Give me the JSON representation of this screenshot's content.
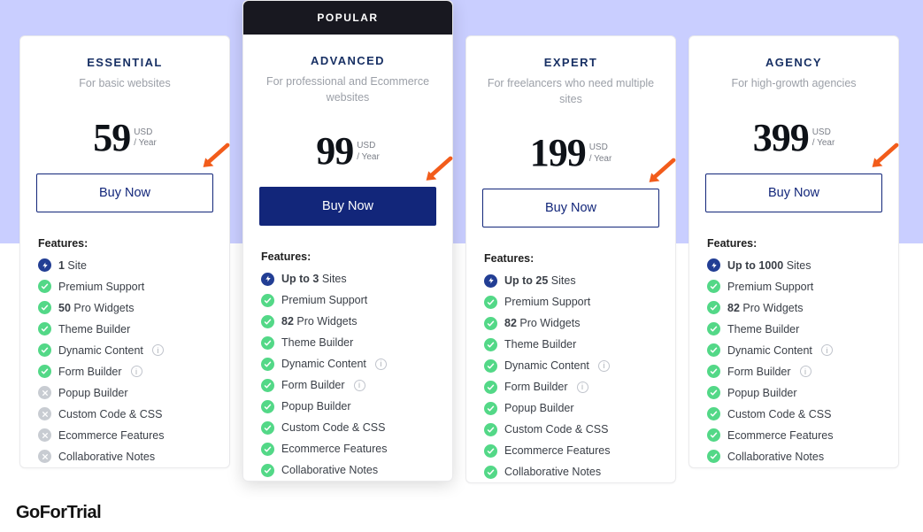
{
  "footer_logo": "GoForTrial",
  "buy_label": "Buy Now",
  "features_title": "Features:",
  "currency": "USD",
  "period": "/ Year",
  "plans": [
    {
      "name": "ESSENTIAL",
      "desc": "For basic websites",
      "price": "59",
      "popular": false,
      "popular_label": "",
      "features": [
        {
          "icon": "bolt",
          "bold": "1",
          "text": " Site",
          "info": false
        },
        {
          "icon": "check",
          "bold": "",
          "text": "Premium Support",
          "info": false
        },
        {
          "icon": "check",
          "bold": "50",
          "text": " Pro Widgets",
          "info": false
        },
        {
          "icon": "check",
          "bold": "",
          "text": "Theme Builder",
          "info": false
        },
        {
          "icon": "check",
          "bold": "",
          "text": "Dynamic Content",
          "info": true
        },
        {
          "icon": "check",
          "bold": "",
          "text": "Form Builder",
          "info": true
        },
        {
          "icon": "no",
          "bold": "",
          "text": "Popup Builder",
          "info": false
        },
        {
          "icon": "no",
          "bold": "",
          "text": "Custom Code & CSS",
          "info": false
        },
        {
          "icon": "no",
          "bold": "",
          "text": "Ecommerce Features",
          "info": false
        },
        {
          "icon": "no",
          "bold": "",
          "text": "Collaborative Notes",
          "info": false
        }
      ]
    },
    {
      "name": "ADVANCED",
      "desc": "For professional and Ecommerce websites",
      "price": "99",
      "popular": true,
      "popular_label": "POPULAR",
      "features": [
        {
          "icon": "bolt",
          "bold": "Up to 3",
          "text": " Sites",
          "info": false
        },
        {
          "icon": "check",
          "bold": "",
          "text": "Premium Support",
          "info": false
        },
        {
          "icon": "check",
          "bold": "82",
          "text": " Pro Widgets",
          "info": false
        },
        {
          "icon": "check",
          "bold": "",
          "text": "Theme Builder",
          "info": false
        },
        {
          "icon": "check",
          "bold": "",
          "text": "Dynamic Content",
          "info": true
        },
        {
          "icon": "check",
          "bold": "",
          "text": "Form Builder",
          "info": true
        },
        {
          "icon": "check",
          "bold": "",
          "text": "Popup Builder",
          "info": false
        },
        {
          "icon": "check",
          "bold": "",
          "text": "Custom Code & CSS",
          "info": false
        },
        {
          "icon": "check",
          "bold": "",
          "text": "Ecommerce Features",
          "info": false
        },
        {
          "icon": "check",
          "bold": "",
          "text": "Collaborative Notes",
          "info": false
        }
      ]
    },
    {
      "name": "EXPERT",
      "desc": "For freelancers who need multiple sites",
      "price": "199",
      "popular": false,
      "popular_label": "",
      "features": [
        {
          "icon": "bolt",
          "bold": "Up to 25",
          "text": " Sites",
          "info": false
        },
        {
          "icon": "check",
          "bold": "",
          "text": "Premium Support",
          "info": false
        },
        {
          "icon": "check",
          "bold": "82",
          "text": " Pro Widgets",
          "info": false
        },
        {
          "icon": "check",
          "bold": "",
          "text": "Theme Builder",
          "info": false
        },
        {
          "icon": "check",
          "bold": "",
          "text": "Dynamic Content",
          "info": true
        },
        {
          "icon": "check",
          "bold": "",
          "text": "Form Builder",
          "info": true
        },
        {
          "icon": "check",
          "bold": "",
          "text": "Popup Builder",
          "info": false
        },
        {
          "icon": "check",
          "bold": "",
          "text": "Custom Code & CSS",
          "info": false
        },
        {
          "icon": "check",
          "bold": "",
          "text": "Ecommerce Features",
          "info": false
        },
        {
          "icon": "check",
          "bold": "",
          "text": "Collaborative Notes",
          "info": false
        }
      ]
    },
    {
      "name": "AGENCY",
      "desc": "For high-growth agencies",
      "price": "399",
      "popular": false,
      "popular_label": "",
      "features": [
        {
          "icon": "bolt",
          "bold": "Up to 1000",
          "text": " Sites",
          "info": false
        },
        {
          "icon": "check",
          "bold": "",
          "text": "Premium Support",
          "info": false
        },
        {
          "icon": "check",
          "bold": "82",
          "text": " Pro Widgets",
          "info": false
        },
        {
          "icon": "check",
          "bold": "",
          "text": "Theme Builder",
          "info": false
        },
        {
          "icon": "check",
          "bold": "",
          "text": "Dynamic Content",
          "info": true
        },
        {
          "icon": "check",
          "bold": "",
          "text": "Form Builder",
          "info": true
        },
        {
          "icon": "check",
          "bold": "",
          "text": "Popup Builder",
          "info": false
        },
        {
          "icon": "check",
          "bold": "",
          "text": "Custom Code & CSS",
          "info": false
        },
        {
          "icon": "check",
          "bold": "",
          "text": "Ecommerce Features",
          "info": false
        },
        {
          "icon": "check",
          "bold": "",
          "text": "Collaborative Notes",
          "info": false
        }
      ]
    }
  ]
}
